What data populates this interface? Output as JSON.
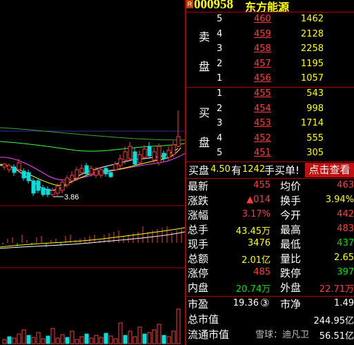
{
  "header": {
    "badge": "R",
    "code": "000958",
    "name": "东方能源"
  },
  "chart": {
    "low_label": "3.86",
    "colors": {
      "up": "#ff3c3c",
      "down": "#00e0e0",
      "ma5": "#ffffff",
      "ma10": "#ffff00",
      "ma20": "#ff40ff",
      "ma60": "#40ff40"
    }
  },
  "orderbook": {
    "sell_label_1": "卖",
    "sell_label_2": "盘",
    "buy_label_1": "买",
    "buy_label_2": "盘",
    "sells": [
      {
        "level": "5",
        "price": "460",
        "vol": "1462"
      },
      {
        "level": "4",
        "price": "459",
        "vol": "2128"
      },
      {
        "level": "3",
        "price": "458",
        "vol": "2258"
      },
      {
        "level": "2",
        "price": "457",
        "vol": "1195"
      },
      {
        "level": "1",
        "price": "456",
        "vol": "1057"
      }
    ],
    "buys": [
      {
        "level": "1",
        "price": "455",
        "vol": "543"
      },
      {
        "level": "2",
        "price": "454",
        "vol": "998"
      },
      {
        "level": "3",
        "price": "453",
        "vol": "1714"
      },
      {
        "level": "4",
        "price": "452",
        "vol": "555"
      },
      {
        "level": "5",
        "price": "451",
        "vol": "305"
      }
    ]
  },
  "buybar": {
    "prefix": "买盘",
    "price": "4.50",
    "mid1": "有",
    "qty": "1242",
    "mid2": "手买单!",
    "button": "点击查看"
  },
  "stats": {
    "latest_label": "最新",
    "latest": "455",
    "avg_label": "均价",
    "avg": "463",
    "chg_label": "涨跌",
    "chg": "▲014",
    "turnover_label": "换手",
    "turnover": "3.94%",
    "pct_label": "涨幅",
    "pct": "3.17%",
    "open_label": "今开",
    "open": "442",
    "total_label": "总手",
    "total": "43.45万",
    "high_label": "最高",
    "high": "483",
    "cur_label": "现手",
    "cur": "3476",
    "low_label": "最低",
    "low": "437",
    "amount_label": "总额",
    "amount": "2.01亿",
    "ratio_label": "量比",
    "ratio": "2.65",
    "limitup_label": "涨停",
    "limitup": "485",
    "limitdown_label": "跌停",
    "limitdown": "397",
    "inner_label": "内盘",
    "inner": "20.74万",
    "outer_label": "外盘",
    "outer": "22.71万",
    "pe_label": "市盈",
    "pe": "19.36",
    "pe_badge": "③",
    "pb_label": "市净",
    "pb": "1.49",
    "mcap_label": "总市值",
    "mcap": "244.95亿",
    "float_label": "流通市值",
    "float": "56.51亿"
  },
  "watermark": "雪球：迪凡卫"
}
